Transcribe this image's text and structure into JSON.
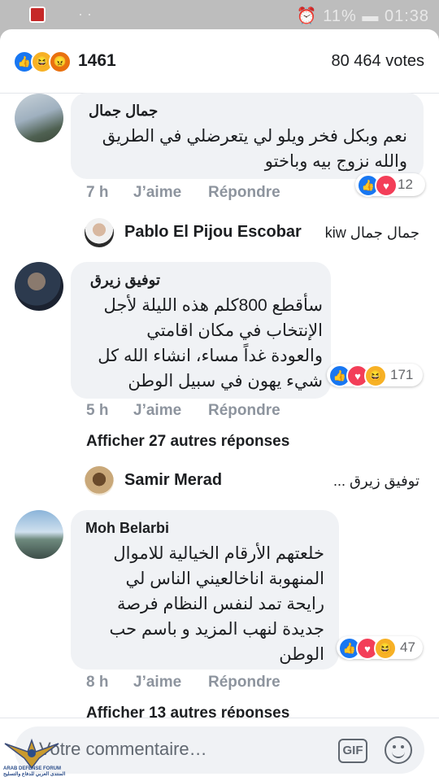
{
  "status_bar": {
    "indicators": "⏰ 11% ▬ 01:38",
    "dots": "· ·",
    "app_icon": "app-notification-icon"
  },
  "summary": {
    "reaction_icons": [
      "like-icon",
      "haha-icon",
      "angry-icon"
    ],
    "reaction_total": "1461",
    "votes": "80 464 votes"
  },
  "comments": [
    {
      "author": "جمال جمال",
      "lines": [
        "نعم وبكل فخر ويلو لي يتعرضلي في الطريق",
        "والله نزوج بيه وباختو"
      ],
      "time": "7 h",
      "like_label": "J’aime",
      "reply_label": "Répondre",
      "reaction_icons": [
        "like-icon",
        "love-icon"
      ],
      "reaction_count": "12",
      "reply_preview": {
        "author": "Pablo El Pijou Escobar",
        "snippet": "جمال جمال kiw"
      }
    },
    {
      "author": "توفيق زيرق",
      "lines": [
        "سأقطع 800كلم هذه الليلة لأجل",
        "الإنتخاب في مكان اقامتي",
        "والعودة غداً مساء، انشاء الله كل",
        "شيء يهون في سبيل الوطن"
      ],
      "time": "5 h",
      "like_label": "J’aime",
      "reply_label": "Répondre",
      "reaction_icons": [
        "like-icon",
        "love-icon",
        "haha-icon"
      ],
      "reaction_count": "171",
      "more_replies": "Afficher 27 autres réponses",
      "reply_preview": {
        "author": "Samir Merad",
        "snippet": "توفيق زيرق ..."
      }
    },
    {
      "author": "Moh Belarbi",
      "lines": [
        "خلعتهم الأرقام الخيالية للاموال",
        "المنهوبة اناخالعيني  الناس لي",
        "رايحة تمد لنفس النظام فرصة",
        "جديدة لنهب المزيد و باسم حب",
        "الوطن"
      ],
      "time": "8 h",
      "like_label": "J’aime",
      "reply_label": "Répondre",
      "reaction_icons": [
        "like-icon",
        "love-icon",
        "haha-icon"
      ],
      "reaction_count": "47",
      "more_replies": "Afficher 13 autres réponses"
    }
  ],
  "composer": {
    "placeholder": "Votre commentaire…",
    "gif_label": "GIF",
    "emoji_icon": "emoji-icon"
  },
  "watermark": {
    "caption": "ARAB DEFENSE FORUM",
    "sub": "المنتدى العربي للدفاع والتسليح"
  }
}
